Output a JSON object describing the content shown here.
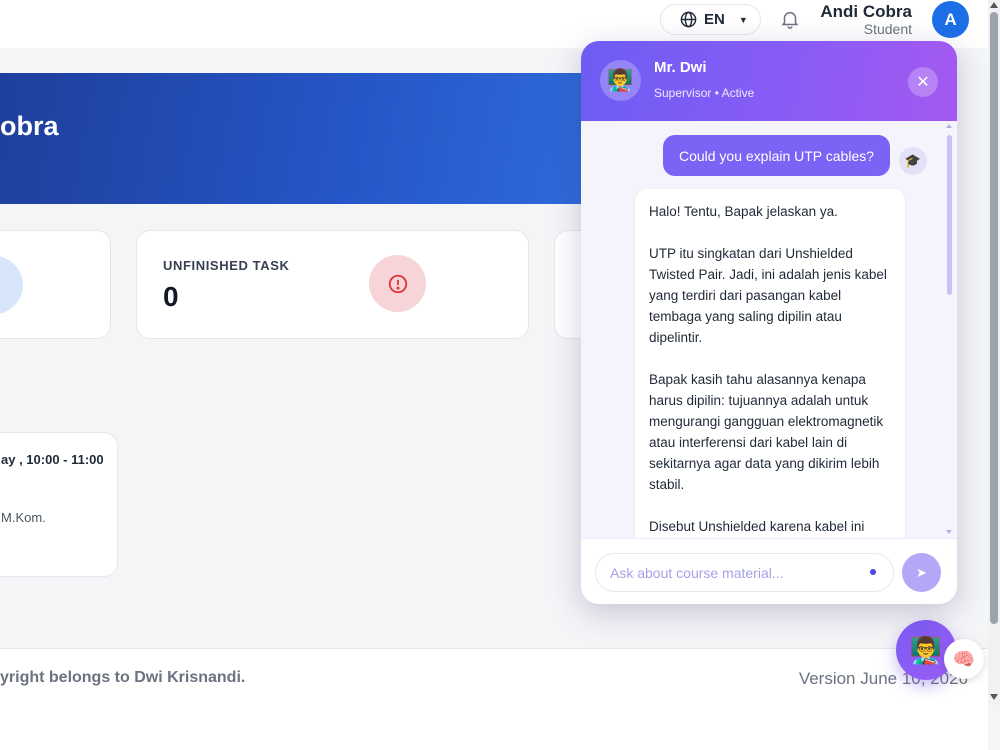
{
  "header": {
    "language": "EN",
    "user_name": "Andi Cobra",
    "user_role": "Student",
    "avatar_initial": "A"
  },
  "banner": {
    "title_partial": "obra"
  },
  "stats": {
    "unfinished_task_label": "UNFINISHED TASK",
    "unfinished_task_value": "0"
  },
  "schedule": {
    "time": "ay , 10:00 - 11:00",
    "teacher": "M.Kom."
  },
  "footer": {
    "copyright": "yright belongs to Dwi Krisnandi.",
    "version": "Version June 10, 2026"
  },
  "chat": {
    "supervisor_name": "Mr. Dwi",
    "supervisor_status": "Supervisor • Active",
    "user_message": "Could you explain UTP cables?",
    "bot_paragraphs": [
      "Halo! Tentu, Bapak jelaskan ya.",
      "UTP itu singkatan dari Unshielded Twisted Pair. Jadi, ini adalah jenis kabel yang terdiri dari pasangan kabel tembaga yang saling dipilin atau dipelintir.",
      "Bapak kasih tahu alasannya kenapa harus dipilin: tujuannya adalah untuk mengurangi gangguan elektromagnetik atau interferensi dari kabel lain di sekitarnya agar data yang dikirim lebih stabil.",
      "Disebut Unshielded karena kabel ini"
    ],
    "input_placeholder": "Ask about course material..."
  },
  "colors": {
    "accent": "#7c63f5",
    "brand_blue": "#2656c7",
    "danger_soft": "#f6d4d7"
  },
  "icons": {
    "language": "globe-icon",
    "notifications": "bell-icon",
    "close": "close-icon",
    "send": "send-icon",
    "user_message": "graduation-cap-icon",
    "launcher_badge": "brain-icon"
  }
}
